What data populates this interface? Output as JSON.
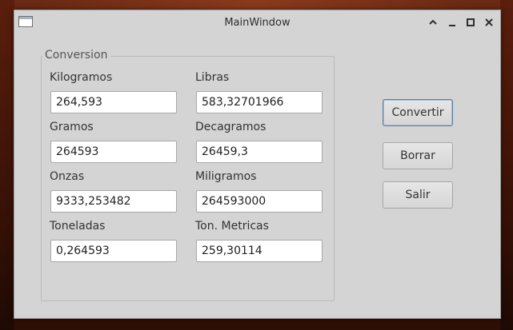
{
  "window": {
    "title": "MainWindow"
  },
  "group": {
    "title": "Conversion"
  },
  "fields": [
    {
      "label": "Kilogramos",
      "value": "264,593"
    },
    {
      "label": "Libras",
      "value": "583,32701966"
    },
    {
      "label": "Gramos",
      "value": "264593"
    },
    {
      "label": "Decagramos",
      "value": "26459,3"
    },
    {
      "label": "Onzas",
      "value": "9333,253482"
    },
    {
      "label": "Miligramos",
      "value": "264593000"
    },
    {
      "label": "Toneladas",
      "value": "0,264593"
    },
    {
      "label": "Ton. Metricas",
      "value": "259,30114"
    }
  ],
  "buttons": {
    "convert": "Convertir",
    "clear": "Borrar",
    "exit": "Salir"
  },
  "colors": {
    "window_bg": "#d4d4d4",
    "default_button_border": "#5f7f9e"
  },
  "icons": {
    "app": "window-icon",
    "titlebar": [
      "chevron-up-icon",
      "minimize-icon",
      "maximize-icon",
      "close-icon"
    ]
  }
}
